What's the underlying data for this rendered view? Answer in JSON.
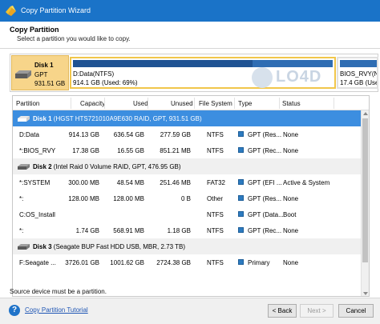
{
  "window": {
    "title": "Copy Partition Wizard"
  },
  "header": {
    "title": "Copy Partition",
    "subtitle": "Select a partition you would like to copy."
  },
  "disk_map": {
    "disk": {
      "name": "Disk 1",
      "type": "GPT",
      "size": "931.51 GB"
    },
    "partitions": [
      {
        "name": "D:Data(NTFS)",
        "info": "914.1 GB (Used: 69%)",
        "used_pct": 69
      },
      {
        "name": "BIOS_RVY(NT",
        "info": "17.4 GB (Use"
      }
    ],
    "watermark": "LO4D"
  },
  "table": {
    "columns": [
      "Partition",
      "Capacity",
      "Used",
      "Unused",
      "File System",
      "Type",
      "Status"
    ],
    "rows": [
      {
        "kind": "disk",
        "label_bold": "Disk 1",
        "label_rest": " (HGST HTS721010A9E630 RAID, GPT, 931.51 GB)",
        "selected": true
      },
      {
        "kind": "part",
        "partition": "D:Data",
        "capacity": "914.13 GB",
        "used": "636.54 GB",
        "unused": "277.59 GB",
        "fs": "NTFS",
        "type": "GPT (Res...",
        "status": "None"
      },
      {
        "kind": "part",
        "partition": "*:BIOS_RVY",
        "capacity": "17.38 GB",
        "used": "16.55 GB",
        "unused": "851.21 MB",
        "fs": "NTFS",
        "type": "GPT (Rec...",
        "status": "None"
      },
      {
        "kind": "disk",
        "label_bold": "Disk 2",
        "label_rest": " (Intel Raid 0 Volume RAID, GPT, 476.95 GB)",
        "selected": false
      },
      {
        "kind": "part",
        "partition": "*:SYSTEM",
        "capacity": "300.00 MB",
        "used": "48.54 MB",
        "unused": "251.46 MB",
        "fs": "FAT32",
        "type": "GPT (EFI ...",
        "status": "Active & System"
      },
      {
        "kind": "part",
        "partition": "*:",
        "capacity": "128.00 MB",
        "used": "128.00 MB",
        "unused": "0 B",
        "fs": "Other",
        "type": "GPT (Res...",
        "status": "None"
      },
      {
        "kind": "part",
        "partition": "C:OS_Install",
        "capacity": "?",
        "used": "?",
        "unused": "?",
        "fs": "NTFS",
        "type": "GPT (Data...",
        "status": "Boot"
      },
      {
        "kind": "part",
        "partition": "*:",
        "capacity": "1.74 GB",
        "used": "568.91 MB",
        "unused": "1.18 GB",
        "fs": "NTFS",
        "type": "GPT (Rec...",
        "status": "None"
      },
      {
        "kind": "disk",
        "label_bold": "Disk 3",
        "label_rest": " (Seagate BUP Fast HDD USB, MBR, 2.73 TB)",
        "selected": false
      },
      {
        "kind": "part",
        "partition": "F:Seagate ...",
        "capacity": "3726.01 GB",
        "used": "1001.62 GB",
        "unused": "2724.38 GB",
        "fs": "NTFS",
        "type": "Primary",
        "status": "None"
      }
    ]
  },
  "note": "Source device must be a partition.",
  "footer": {
    "help_link": "Copy Partition Tutorial",
    "back": "< Back",
    "next": "Next >",
    "cancel": "Cancel"
  },
  "colors": {
    "titlebar": "#1a73c8",
    "selected_row": "#3c8ee0",
    "disk_highlight": "#f7d58a",
    "partition_bar": "#2f6db3"
  }
}
